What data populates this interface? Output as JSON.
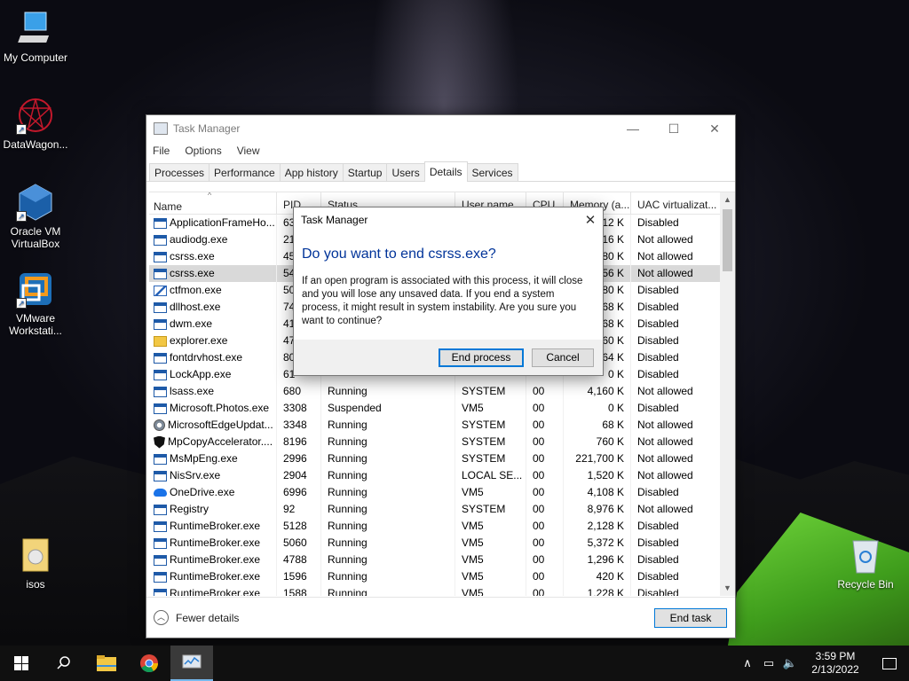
{
  "desktop": {
    "icons": [
      {
        "label": "My Computer"
      },
      {
        "label": "DataWagon..."
      },
      {
        "label": "Oracle VM VirtualBox"
      },
      {
        "label": "VMware Workstati..."
      },
      {
        "label": "isos"
      },
      {
        "label": "Recycle Bin"
      }
    ]
  },
  "taskmanager": {
    "title": "Task Manager",
    "menu": [
      "File",
      "Options",
      "View"
    ],
    "tabs": [
      "Processes",
      "Performance",
      "App history",
      "Startup",
      "Users",
      "Details",
      "Services"
    ],
    "active_tab": "Details",
    "columns": [
      "Name",
      "PID",
      "Status",
      "User name",
      "CPU",
      "Memory (a...",
      "UAC virtualizat..."
    ],
    "rows": [
      {
        "name": "ApplicationFrameHo...",
        "pid": "63",
        "status": "",
        "user": "",
        "cpu": "",
        "mem": "12 K",
        "uac": "Disabled",
        "icon": "app"
      },
      {
        "name": "audiodg.exe",
        "pid": "21",
        "status": "",
        "user": "",
        "cpu": "",
        "mem": "16 K",
        "uac": "Not allowed",
        "icon": "app"
      },
      {
        "name": "csrss.exe",
        "pid": "45",
        "status": "",
        "user": "",
        "cpu": "",
        "mem": "80 K",
        "uac": "Not allowed",
        "icon": "app"
      },
      {
        "name": "csrss.exe",
        "pid": "54",
        "status": "",
        "user": "",
        "cpu": "",
        "mem": "56 K",
        "uac": "Not allowed",
        "icon": "app",
        "selected": true
      },
      {
        "name": "ctfmon.exe",
        "pid": "50",
        "status": "",
        "user": "",
        "cpu": "",
        "mem": "80 K",
        "uac": "Disabled",
        "icon": "pen"
      },
      {
        "name": "dllhost.exe",
        "pid": "74",
        "status": "",
        "user": "",
        "cpu": "",
        "mem": "68 K",
        "uac": "Disabled",
        "icon": "app"
      },
      {
        "name": "dwm.exe",
        "pid": "41",
        "status": "",
        "user": "",
        "cpu": "",
        "mem": "68 K",
        "uac": "Disabled",
        "icon": "app"
      },
      {
        "name": "explorer.exe",
        "pid": "47",
        "status": "",
        "user": "",
        "cpu": "",
        "mem": "60 K",
        "uac": "Disabled",
        "icon": "folder"
      },
      {
        "name": "fontdrvhost.exe",
        "pid": "80",
        "status": "",
        "user": "",
        "cpu": "",
        "mem": "64 K",
        "uac": "Disabled",
        "icon": "app"
      },
      {
        "name": "LockApp.exe",
        "pid": "61",
        "status": "",
        "user": "",
        "cpu": "",
        "mem": "0 K",
        "uac": "Disabled",
        "icon": "app"
      },
      {
        "name": "lsass.exe",
        "pid": "680",
        "status": "Running",
        "user": "SYSTEM",
        "cpu": "00",
        "mem": "4,160 K",
        "uac": "Not allowed",
        "icon": "app"
      },
      {
        "name": "Microsoft.Photos.exe",
        "pid": "3308",
        "status": "Suspended",
        "user": "VM5",
        "cpu": "00",
        "mem": "0 K",
        "uac": "Disabled",
        "icon": "app"
      },
      {
        "name": "MicrosoftEdgeUpdat...",
        "pid": "3348",
        "status": "Running",
        "user": "SYSTEM",
        "cpu": "00",
        "mem": "68 K",
        "uac": "Not allowed",
        "icon": "gear"
      },
      {
        "name": "MpCopyAccelerator....",
        "pid": "8196",
        "status": "Running",
        "user": "SYSTEM",
        "cpu": "00",
        "mem": "760 K",
        "uac": "Not allowed",
        "icon": "shield"
      },
      {
        "name": "MsMpEng.exe",
        "pid": "2996",
        "status": "Running",
        "user": "SYSTEM",
        "cpu": "00",
        "mem": "221,700 K",
        "uac": "Not allowed",
        "icon": "app"
      },
      {
        "name": "NisSrv.exe",
        "pid": "2904",
        "status": "Running",
        "user": "LOCAL SE...",
        "cpu": "00",
        "mem": "1,520 K",
        "uac": "Not allowed",
        "icon": "app"
      },
      {
        "name": "OneDrive.exe",
        "pid": "6996",
        "status": "Running",
        "user": "VM5",
        "cpu": "00",
        "mem": "4,108 K",
        "uac": "Disabled",
        "icon": "cloud"
      },
      {
        "name": "Registry",
        "pid": "92",
        "status": "Running",
        "user": "SYSTEM",
        "cpu": "00",
        "mem": "8,976 K",
        "uac": "Not allowed",
        "icon": "app"
      },
      {
        "name": "RuntimeBroker.exe",
        "pid": "5128",
        "status": "Running",
        "user": "VM5",
        "cpu": "00",
        "mem": "2,128 K",
        "uac": "Disabled",
        "icon": "app"
      },
      {
        "name": "RuntimeBroker.exe",
        "pid": "5060",
        "status": "Running",
        "user": "VM5",
        "cpu": "00",
        "mem": "5,372 K",
        "uac": "Disabled",
        "icon": "app"
      },
      {
        "name": "RuntimeBroker.exe",
        "pid": "4788",
        "status": "Running",
        "user": "VM5",
        "cpu": "00",
        "mem": "1,296 K",
        "uac": "Disabled",
        "icon": "app"
      },
      {
        "name": "RuntimeBroker.exe",
        "pid": "1596",
        "status": "Running",
        "user": "VM5",
        "cpu": "00",
        "mem": "420 K",
        "uac": "Disabled",
        "icon": "app"
      },
      {
        "name": "RuntimeBroker.exe",
        "pid": "1588",
        "status": "Running",
        "user": "VM5",
        "cpu": "00",
        "mem": "1,228 K",
        "uac": "Disabled",
        "icon": "app"
      }
    ],
    "fewer_details": "Fewer details",
    "end_task": "End task"
  },
  "dialog": {
    "title": "Task Manager",
    "heading": "Do you want to end csrss.exe?",
    "message": "If an open program is associated with this process, it will close and you will lose any unsaved data. If you end a system process, it might result in system instability. Are you sure you want to continue?",
    "end_process": "End process",
    "cancel": "Cancel"
  },
  "taskbar": {
    "time": "3:59 PM",
    "date": "2/13/2022"
  }
}
